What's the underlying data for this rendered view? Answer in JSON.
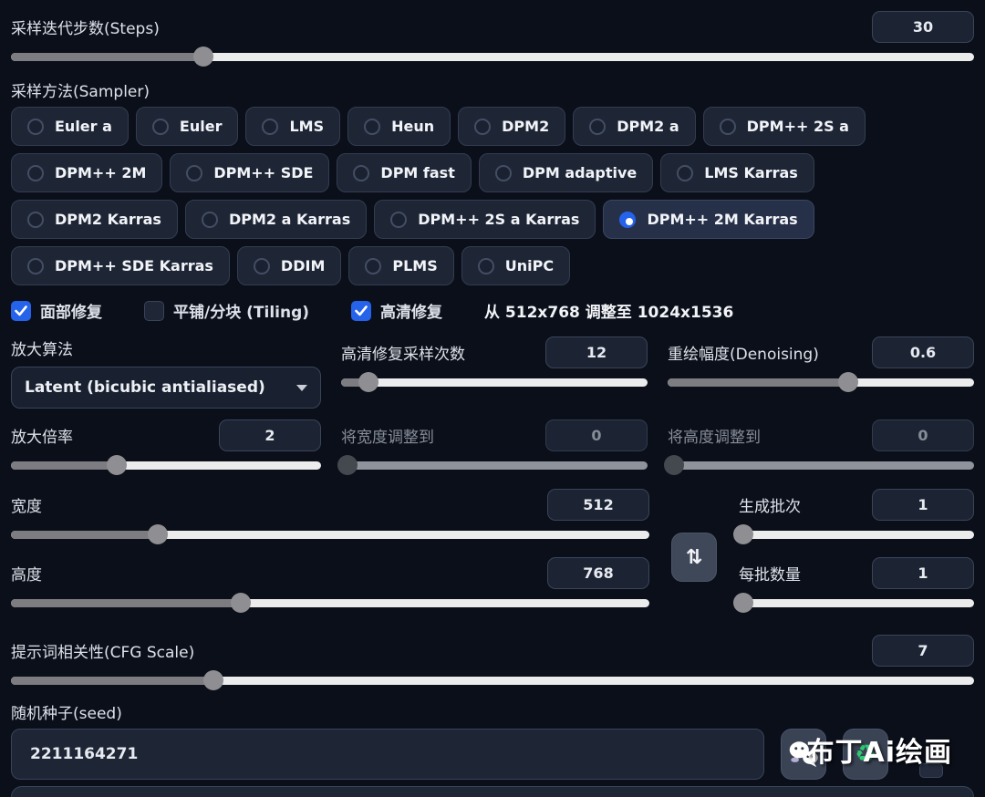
{
  "colors": {
    "accent": "#2563eb",
    "recycle_green": "#2ecc71"
  },
  "steps": {
    "label": "采样迭代步数(Steps)",
    "value": "30",
    "percent": 20
  },
  "sampler": {
    "label": "采样方法(Sampler)",
    "selected": "DPM++ 2M Karras",
    "options": [
      "Euler a",
      "Euler",
      "LMS",
      "Heun",
      "DPM2",
      "DPM2 a",
      "DPM++ 2S a",
      "DPM++ 2M",
      "DPM++ SDE",
      "DPM fast",
      "DPM adaptive",
      "LMS Karras",
      "DPM2 Karras",
      "DPM2 a Karras",
      "DPM++ 2S a Karras",
      "DPM++ 2M Karras",
      "DPM++ SDE Karras",
      "DDIM",
      "PLMS",
      "UniPC"
    ]
  },
  "toggles": {
    "restore_faces": {
      "label": "面部修复",
      "checked": true
    },
    "tiling": {
      "label": "平铺/分块 (Tiling)",
      "checked": false
    },
    "hires_fix": {
      "label": "高清修复",
      "checked": true
    },
    "resize_info": "从 512x768 调整至 1024x1536"
  },
  "upscaler": {
    "label": "放大算法",
    "value": "Latent (bicubic antialiased)"
  },
  "hires_steps": {
    "label": "高清修复采样次数",
    "value": "12",
    "percent": 9
  },
  "denoising": {
    "label": "重绘幅度(Denoising)",
    "value": "0.6",
    "percent": 59
  },
  "upscale_by": {
    "label": "放大倍率",
    "value": "2",
    "percent": 34
  },
  "resize_width": {
    "label": "将宽度调整到",
    "value": "0",
    "percent": 2,
    "disabled": true
  },
  "resize_height": {
    "label": "将高度调整到",
    "value": "0",
    "percent": 2,
    "disabled": true
  },
  "width": {
    "label": "宽度",
    "value": "512",
    "percent": 23
  },
  "height": {
    "label": "高度",
    "value": "768",
    "percent": 36
  },
  "batch_count": {
    "label": "生成批次",
    "value": "1",
    "percent": 2
  },
  "batch_size": {
    "label": "每批数量",
    "value": "1",
    "percent": 2
  },
  "cfg": {
    "label": "提示词相关性(CFG Scale)",
    "value": "7",
    "percent": 21
  },
  "seed": {
    "label": "随机种子(seed)",
    "value": "2211164271"
  },
  "swap_button": {
    "icon": "⇅"
  },
  "seed_buttons": {
    "recycle_icon": "♻"
  },
  "watermark": {
    "text": "布丁Ai绘画"
  }
}
